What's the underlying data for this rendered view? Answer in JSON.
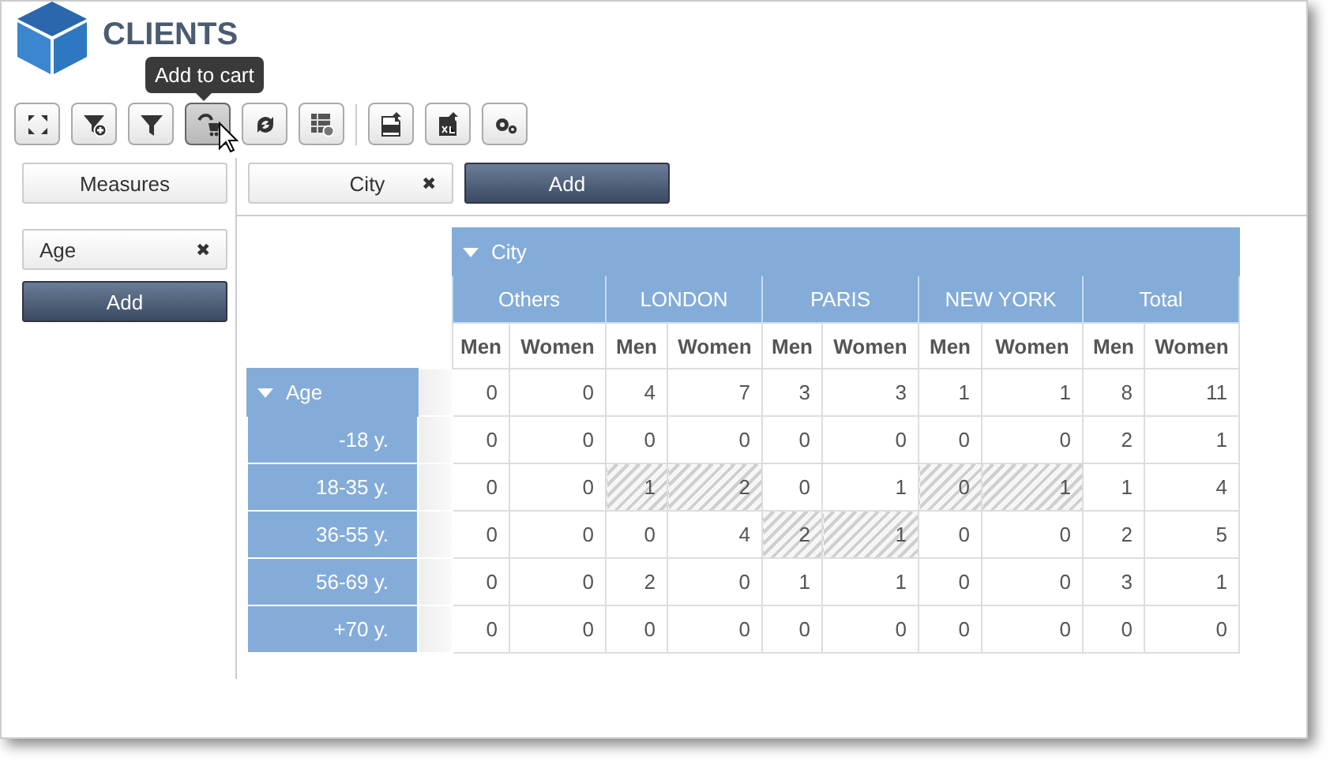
{
  "app": {
    "title": "CLIENTS"
  },
  "tooltip": {
    "text": "Add to cart"
  },
  "toolbar": [
    {
      "kind": "expand",
      "hovered": false
    },
    {
      "kind": "filter-add",
      "hovered": false
    },
    {
      "kind": "filter",
      "hovered": false
    },
    {
      "kind": "cart",
      "hovered": true
    },
    {
      "kind": "refresh",
      "hovered": false
    },
    {
      "kind": "table-settings",
      "hovered": false
    },
    {
      "kind": "separator"
    },
    {
      "kind": "pdf",
      "hovered": false
    },
    {
      "kind": "excel",
      "hovered": false
    },
    {
      "kind": "settings",
      "hovered": false
    }
  ],
  "measures_button": "Measures",
  "column_fields": [
    {
      "label": "City",
      "remove": "✖"
    }
  ],
  "column_add": "Add",
  "row_fields": [
    {
      "label": "Age",
      "remove": "✖"
    }
  ],
  "row_add": "Add",
  "table": {
    "column_dimension": {
      "label": "City",
      "expanded": true
    },
    "row_dimension": {
      "label": "Age",
      "expanded": true
    },
    "groups": [
      {
        "label": "Others",
        "subheaders": [
          "Men",
          "Women"
        ]
      },
      {
        "label": "LONDON",
        "subheaders": [
          "Men",
          "Women"
        ]
      },
      {
        "label": "PARIS",
        "subheaders": [
          "Men",
          "Women"
        ]
      },
      {
        "label": "NEW YORK",
        "subheaders": [
          "Men",
          "Women"
        ]
      },
      {
        "label": "Total",
        "subheaders": [
          "Men",
          "Women"
        ]
      }
    ],
    "rows": [
      {
        "kind": "dimension",
        "cells": [
          {
            "value": "0",
            "hatched": false
          },
          {
            "value": "0",
            "hatched": false
          },
          {
            "value": "4",
            "hatched": false
          },
          {
            "value": "7",
            "hatched": false
          },
          {
            "value": "3",
            "hatched": false
          },
          {
            "value": "3",
            "hatched": false
          },
          {
            "value": "1",
            "hatched": false
          },
          {
            "value": "1",
            "hatched": false
          },
          {
            "value": "8",
            "hatched": false
          },
          {
            "value": "11",
            "hatched": false
          }
        ]
      },
      {
        "kind": "member",
        "label": "-18 y.",
        "cells": [
          {
            "value": "0",
            "hatched": false
          },
          {
            "value": "0",
            "hatched": false
          },
          {
            "value": "0",
            "hatched": false
          },
          {
            "value": "0",
            "hatched": false
          },
          {
            "value": "0",
            "hatched": false
          },
          {
            "value": "0",
            "hatched": false
          },
          {
            "value": "0",
            "hatched": false
          },
          {
            "value": "0",
            "hatched": false
          },
          {
            "value": "2",
            "hatched": false
          },
          {
            "value": "1",
            "hatched": false
          }
        ]
      },
      {
        "kind": "member",
        "label": "18-35 y.",
        "cells": [
          {
            "value": "0",
            "hatched": false
          },
          {
            "value": "0",
            "hatched": false
          },
          {
            "value": "1",
            "hatched": true
          },
          {
            "value": "2",
            "hatched": true
          },
          {
            "value": "0",
            "hatched": false
          },
          {
            "value": "1",
            "hatched": false
          },
          {
            "value": "0",
            "hatched": true
          },
          {
            "value": "1",
            "hatched": true
          },
          {
            "value": "1",
            "hatched": false
          },
          {
            "value": "4",
            "hatched": false
          }
        ]
      },
      {
        "kind": "member",
        "label": "36-55 y.",
        "cells": [
          {
            "value": "0",
            "hatched": false
          },
          {
            "value": "0",
            "hatched": false
          },
          {
            "value": "0",
            "hatched": false
          },
          {
            "value": "4",
            "hatched": false
          },
          {
            "value": "2",
            "hatched": true
          },
          {
            "value": "1",
            "hatched": true
          },
          {
            "value": "0",
            "hatched": false
          },
          {
            "value": "0",
            "hatched": false
          },
          {
            "value": "2",
            "hatched": false
          },
          {
            "value": "5",
            "hatched": false
          }
        ]
      },
      {
        "kind": "member",
        "label": "56-69 y.",
        "cells": [
          {
            "value": "0",
            "hatched": false
          },
          {
            "value": "0",
            "hatched": false
          },
          {
            "value": "2",
            "hatched": false
          },
          {
            "value": "0",
            "hatched": false
          },
          {
            "value": "1",
            "hatched": false
          },
          {
            "value": "1",
            "hatched": false
          },
          {
            "value": "0",
            "hatched": false
          },
          {
            "value": "0",
            "hatched": false
          },
          {
            "value": "3",
            "hatched": false
          },
          {
            "value": "1",
            "hatched": false
          }
        ]
      },
      {
        "kind": "member",
        "label": "+70 y.",
        "cells": [
          {
            "value": "0",
            "hatched": false
          },
          {
            "value": "0",
            "hatched": false
          },
          {
            "value": "0",
            "hatched": false
          },
          {
            "value": "0",
            "hatched": false
          },
          {
            "value": "0",
            "hatched": false
          },
          {
            "value": "0",
            "hatched": false
          },
          {
            "value": "0",
            "hatched": false
          },
          {
            "value": "0",
            "hatched": false
          },
          {
            "value": "0",
            "hatched": false
          },
          {
            "value": "0",
            "hatched": false
          }
        ]
      }
    ]
  }
}
